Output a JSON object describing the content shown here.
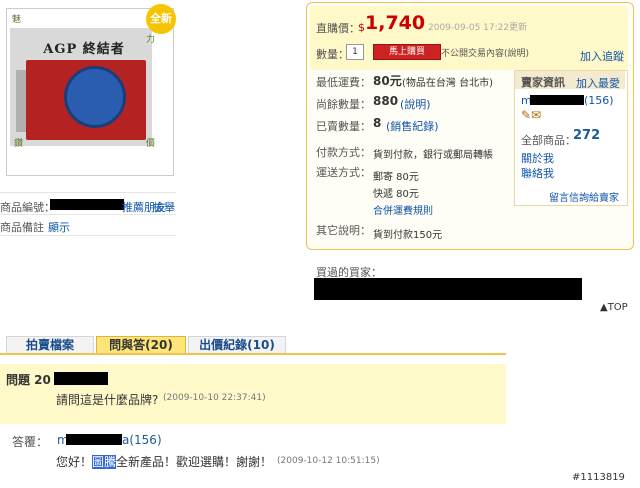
{
  "photo": {
    "title": "AGP 終結者",
    "badge": "全新",
    "corners": [
      "魅",
      "力",
      "鑽",
      "價"
    ]
  },
  "left_info": {
    "product_code_label": "商品編號：",
    "recommend_link": "推薦朋友",
    "report_link": "檢舉",
    "note_label": "商品備註",
    "note_link": "顯示"
  },
  "price_panel": {
    "price_label": "直購價：",
    "currency": "$",
    "price": "1,740",
    "updated": "2009-09-05 17:22更新",
    "qty_label": "數量：",
    "qty_value": "1",
    "buy_button": "馬上購買",
    "buy_note": "不公開交易內容(說明)",
    "watch_link": "加入追蹤",
    "shipping_label": "最低運費：",
    "shipping_value": "80元",
    "shipping_note": "(物品在台灣 台北市)",
    "stock_label": "尚餘數量：",
    "stock_value": "880",
    "stock_link": "(說明)",
    "sold_label": "已賣數量：",
    "sold_value": "8",
    "sold_link": "(銷售紀錄)",
    "payment_label": "付款方式：",
    "payment_value": "貨到付款，銀行或郵局轉帳",
    "delivery_label": "運送方式：",
    "delivery_1": "郵寄  80元",
    "delivery_2": "快遞  80元",
    "delivery_link": "合併運費規則",
    "other_label": "其它說明：",
    "other_value": "貨到付款150元"
  },
  "seller": {
    "header": "賣家資訊",
    "favorite_link": "加入最愛",
    "name_prefix": "m",
    "name_suffix": "(156)",
    "total_label": "全部商品：",
    "total_value": "272",
    "about_link": "關於我",
    "contact_link": "聯絡我",
    "message_link": "留言信詢給賣家"
  },
  "buyers_label": "買過的買家：",
  "top_link": "▲TOP",
  "tabs": [
    "拍賣檔案",
    "問與答(20)",
    "出價紀錄(10)"
  ],
  "question": {
    "title": "問題 20",
    "text": "請問這是什麼品牌?",
    "time": "(2009-10-10 22:37:41)"
  },
  "answer": {
    "label": "答覆：",
    "name_prefix": "m",
    "name_suffix": "a(156)",
    "text_before": "您好！",
    "text_highlight": "圖騰",
    "text_after": "全新產品！歡迎選購！謝謝！",
    "time": "(2009-10-12 10:51:15)"
  },
  "watermark": "#1113819",
  "colors": {
    "price_red": "#cc0000",
    "link_blue": "#1155aa",
    "accent_yellow": "#fde57a",
    "panel_border": "#f0c24e"
  }
}
